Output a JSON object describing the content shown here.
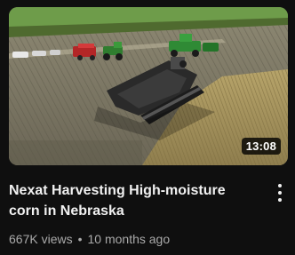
{
  "video": {
    "duration": "13:08",
    "title_line1": "Nexat Harvesting High-moisture",
    "title_line2": "corn in Nebraska",
    "views": "667K views",
    "separator": "•",
    "age": "10 months ago"
  },
  "icons": {
    "more_actions": "vertical-ellipsis-icon"
  },
  "colors": {
    "background": "#0f0f0f",
    "title": "#f1f1f1",
    "meta": "#aaaaaa",
    "duration_badge": "#000000"
  }
}
